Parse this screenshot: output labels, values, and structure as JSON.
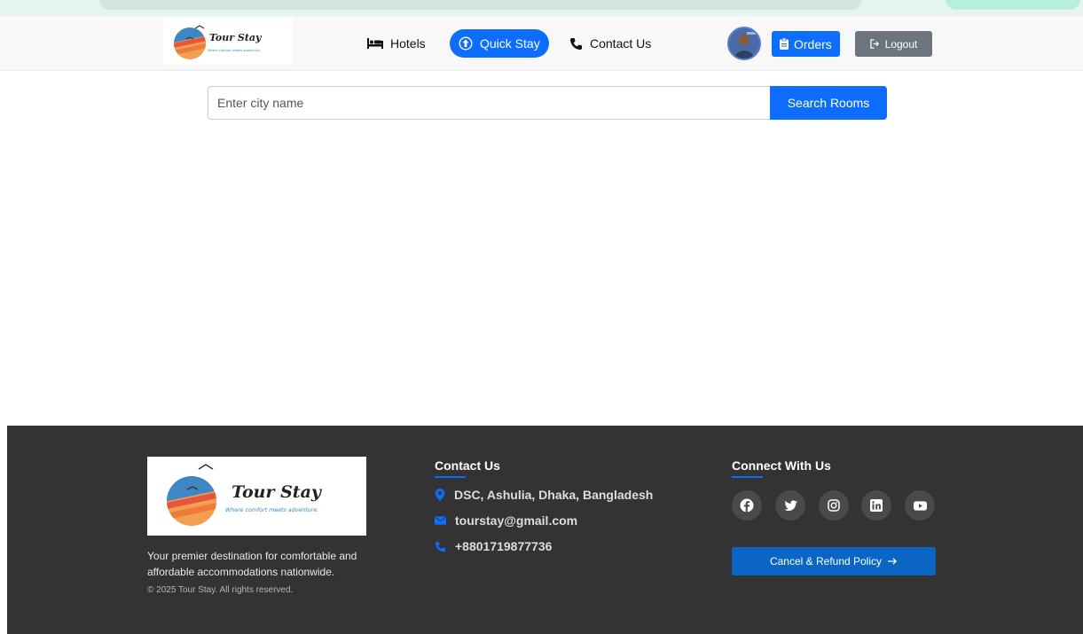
{
  "brand": {
    "name": "Tour Stay",
    "tagline": "Where comfort meets adventure."
  },
  "nav": {
    "hotels_label": "Hotels",
    "quick_stay_label": "Quick Stay",
    "contact_label": "Contact Us",
    "orders_label": "Orders",
    "logout_label": "Logout"
  },
  "search": {
    "placeholder": "Enter city name",
    "value": "",
    "button_label": "Search Rooms"
  },
  "footer": {
    "description": "Your premier destination for comfortable and affordable accommodations nationwide.",
    "copyright": "© 2025 Tour Stay. All rights reserved.",
    "contact_heading": "Contact Us",
    "address": "DSC, Ashulia, Dhaka, Bangladesh",
    "email": "tourstay@gmail.com",
    "phone": "+8801719877736",
    "connect_heading": "Connect With Us",
    "social_icons": [
      "facebook-icon",
      "twitter-icon",
      "instagram-icon",
      "linkedin-icon",
      "youtube-icon"
    ],
    "refund_label": "Cancel & Refund Policy"
  },
  "colors": {
    "primary": "#0d6efd",
    "secondary": "#6c757d",
    "footer_bg": "#333333",
    "refund_btn": "#0a66c2"
  }
}
